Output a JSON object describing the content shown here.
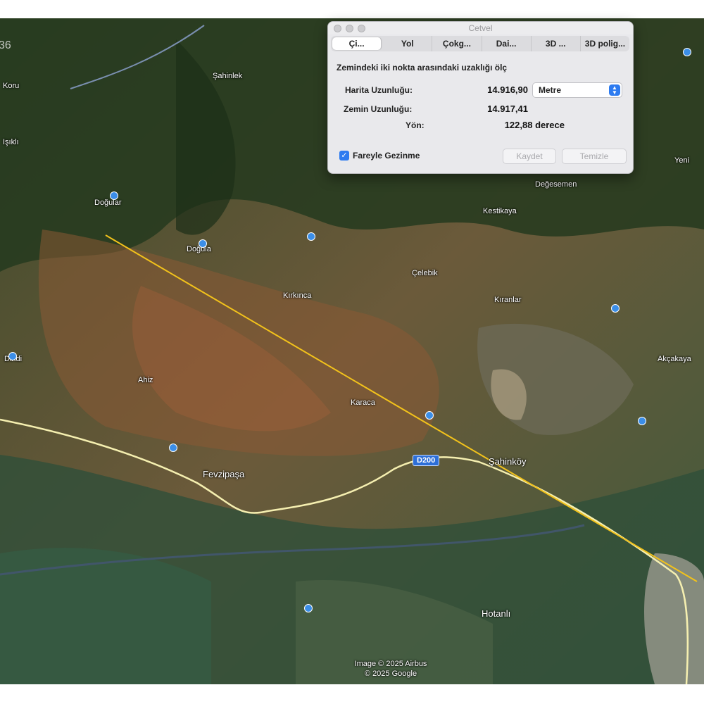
{
  "dialog": {
    "title": "Cetvel",
    "tabs": [
      "Çi...",
      "Yol",
      "Çokg...",
      "Dai...",
      "3D ...",
      "3D polig..."
    ],
    "active_tab_index": 0,
    "subtitle": "Zemindeki iki nokta arasındaki uzaklığı ölç",
    "map_length_label": "Harita Uzunluğu:",
    "map_length_value": "14.916,90",
    "unit": "Metre",
    "ground_length_label": "Zemin Uzunluğu:",
    "ground_length_value": "14.917,41",
    "heading_label": "Yön:",
    "heading_value": "122,88 derece",
    "mouse_nav_label": "Fareyle Gezinme",
    "mouse_nav_checked": true,
    "save_label": "Kaydet",
    "clear_label": "Temizle"
  },
  "map": {
    "corner_text": "36",
    "road_shield": "D200",
    "places": [
      "Şahinlek",
      "Doğular",
      "Doğula",
      "Yeni",
      "Değesemen",
      "Kestikaya",
      "Çelebik",
      "Kırkınca",
      "Kıranlar",
      "Akçakaya",
      "Karaca",
      "Şahinköy",
      "Fevzipaşa",
      "Ahiz",
      "Hotanlı",
      "Dindi",
      "Koru",
      "Işıklı"
    ],
    "copyright_line1": "Image © 2025 Airbus",
    "copyright_line2": "© 2025 Google",
    "measure_line_color": "#f2c21b",
    "highway_color": "#f5efb0"
  }
}
